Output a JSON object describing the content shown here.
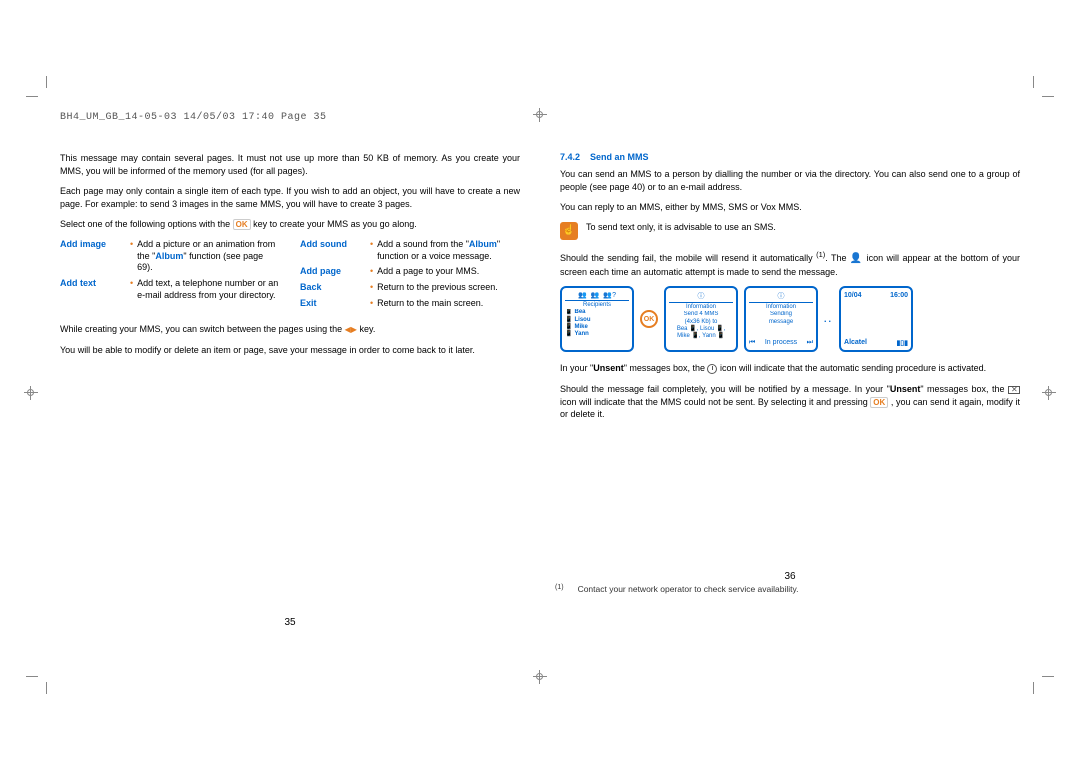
{
  "header": "BH4_UM_GB_14-05-03  14/05/03  17:40  Page 35",
  "left": {
    "p1": "This message may contain several pages. It must not use up more than 50 KB of memory. As you create your MMS, you will be informed of the memory used (for all pages).",
    "p2": "Each page may only contain a single item of each type. If you wish to add an object, you will have to create a new page. For example: to send 3 images in the same MMS, you will have to create 3 pages.",
    "p3a": "Select one of the following options with the ",
    "p3b": " key to create your MMS as you go along.",
    "options": {
      "add_image": {
        "label": "Add image",
        "desc": "Add a picture or an animation from the \"Album\" function (see page 69)."
      },
      "add_text": {
        "label": "Add text",
        "desc": "Add text, a telephone number or an e-mail address from your directory."
      },
      "add_sound": {
        "label": "Add sound",
        "desc": "Add a sound from the \"Album\" function or a voice message."
      },
      "add_page": {
        "label": "Add page",
        "desc": "Add a page to your MMS."
      },
      "back": {
        "label": "Back",
        "desc": "Return to the previous screen."
      },
      "exit": {
        "label": "Exit",
        "desc": "Return to the main screen."
      }
    },
    "p4a": "While creating your MMS, you can switch between the pages using the ",
    "p4b": " key.",
    "p5": "You will be able to modify or delete an item or page, save your message in order to come back to it later.",
    "page_num": "35"
  },
  "right": {
    "section_num": "7.4.2",
    "section_title": "Send an MMS",
    "p1": "You can send an MMS to a person by dialling the number or via the directory. You can also send one to a group of people (see page 40) or to an e-mail address.",
    "p2": "You can reply to an MMS, either by MMS, SMS or Vox MMS.",
    "tip": "To send text only, it is advisable to use an SMS.",
    "p3a": "Should the sending fail, the mobile will resend it automatically ",
    "p3_sup": "(1)",
    "p3b": ". The ",
    "p3c": " icon will appear at the bottom of your screen each time an automatic attempt is made to send the message.",
    "p4a": "In your \"",
    "p4_unsent": "Unsent",
    "p4b": "\" messages box, the ",
    "p4c": " icon will indicate that the automatic sending procedure is activated.",
    "p5a": "Should the message fail completely, you will be notified by a message. In your \"",
    "p5b": "\" messages box, the ",
    "p5c": " icon will indicate that the MMS could not be sent. By selecting it and pressing ",
    "p5d": " , you can send it again, modify it or delete it.",
    "screens": {
      "s1": {
        "title": "Recipients",
        "rows": [
          "Bea",
          "Lisou",
          "Mike",
          "Yann"
        ]
      },
      "s2": {
        "title": "Information",
        "l1": "Send 4 MMS",
        "l2": "(4x36 Kb) to",
        "l3": "Bea 📱, Lisou 📱,",
        "l4": "Mike 📱, Yann 📱"
      },
      "s3": {
        "title": "Information",
        "l1": "Sending",
        "l2": "message",
        "footer": "In process"
      },
      "s4": {
        "date": "10/04",
        "time": "16:00",
        "brand": "Alcatel"
      }
    },
    "footnote_sup": "(1)",
    "footnote": "Contact your network operator to check service availability.",
    "page_num": "36"
  }
}
